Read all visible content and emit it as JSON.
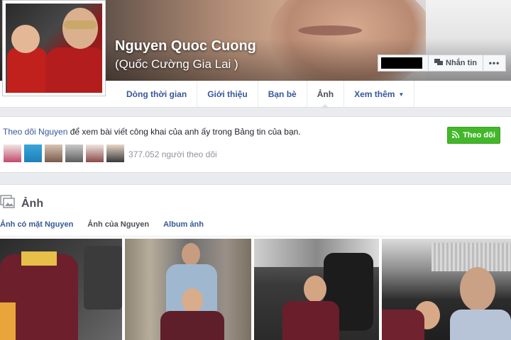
{
  "profile": {
    "name": "Nguyen Quoc Cuong",
    "alternate_name": "(Quốc Cường Gia Lai )"
  },
  "cover_actions": {
    "message_label": "Nhắn tin",
    "more_label": "•••"
  },
  "tabs": [
    {
      "label": "Dòng thời gian"
    },
    {
      "label": "Giới thiệu"
    },
    {
      "label": "Bạn bè"
    },
    {
      "label": "Ảnh"
    },
    {
      "label": "Xem thêm"
    }
  ],
  "active_tab": "Ảnh",
  "follow": {
    "link_text": "Theo dõi Nguyen",
    "rest_text": " để xem bài viết công khai của anh ấy trong Bảng tin của bạn.",
    "button_label": "Theo dõi",
    "follower_count": "377.052 người theo dõi"
  },
  "photos": {
    "title": "Ảnh",
    "subtabs": [
      {
        "label": "Ảnh có mặt Nguyen"
      },
      {
        "label": "Ảnh của Nguyen"
      },
      {
        "label": "Album ảnh"
      }
    ],
    "active_subtab": "Ảnh của Nguyen"
  },
  "colors": {
    "link": "#365899",
    "follow_green": "#42b72a",
    "page_bg": "#e9ebee"
  }
}
